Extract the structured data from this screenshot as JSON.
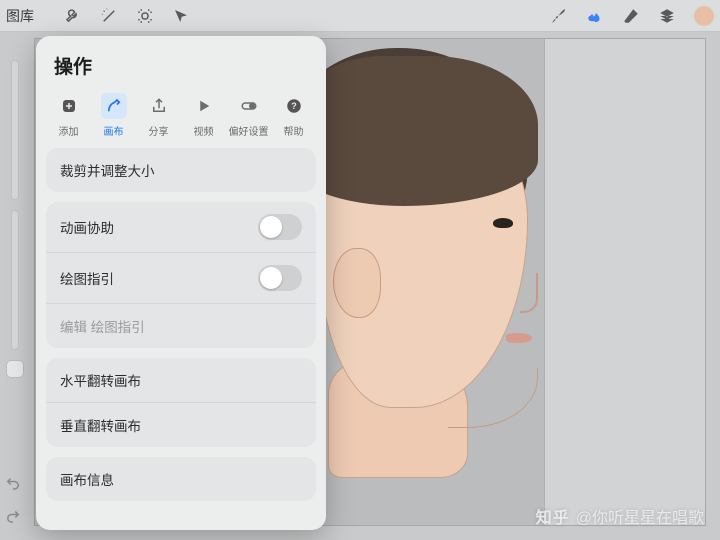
{
  "topbar": {
    "gallery_label": "图库"
  },
  "panel": {
    "title": "操作",
    "tabs": [
      {
        "label": "添加"
      },
      {
        "label": "画布"
      },
      {
        "label": "分享"
      },
      {
        "label": "视频"
      },
      {
        "label": "偏好设置"
      },
      {
        "label": "帮助"
      }
    ],
    "rows": {
      "crop_resize": "裁剪并调整大小",
      "animation_assist": "动画协助",
      "drawing_guide": "绘图指引",
      "edit_drawing_guide": "编辑 绘图指引",
      "flip_h": "水平翻转画布",
      "flip_v": "垂直翻转画布",
      "canvas_info": "画布信息"
    },
    "toggles": {
      "animation_assist": false,
      "drawing_guide": false
    }
  },
  "watermark": {
    "site": "知乎",
    "at": "@你听星星在唱歌"
  },
  "colors": {
    "brand_blue": "#1a73f0",
    "swatch": "#e8bfa4"
  }
}
